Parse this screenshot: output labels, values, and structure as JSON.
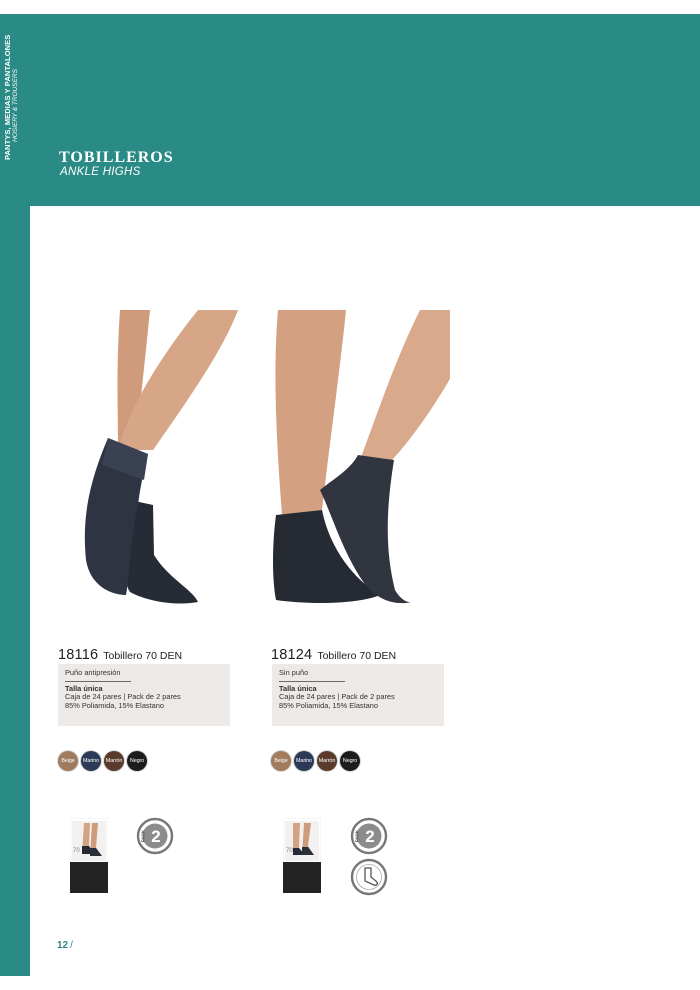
{
  "sidebar": {
    "category": "PANTYS, MEDIAS Y PANTALONES",
    "category_en": "HOSIERY & TROUSERS"
  },
  "section": {
    "title": "TOBILLEROS",
    "subtitle": "ANKLE HIGHS"
  },
  "products": [
    {
      "code": "18116",
      "name": "Tobillero 70 DEN",
      "feature": "Puño antipresión",
      "size": "Talla única",
      "packaging": "Caja de 24 pares | Pack de 2 pares",
      "composition": "85% Poliamida, 15% Elastano",
      "colors": [
        {
          "label": "Beige",
          "hex": "#a07b5e"
        },
        {
          "label": "Marino",
          "hex": "#2c3a58"
        },
        {
          "label": "Marrón",
          "hex": "#5a3a2a"
        },
        {
          "label": "Negro",
          "hex": "#1c1c1c"
        }
      ],
      "pack_badge": "2",
      "pack_badge_label": "PACK"
    },
    {
      "code": "18124",
      "name": "Tobillero 70 DEN",
      "feature": "Sin puño",
      "size": "Talla única",
      "packaging": "Caja de 24 pares | Pack de 2 pares",
      "composition": "85% Poliamida, 15% Elastano",
      "colors": [
        {
          "label": "Beige",
          "hex": "#a07b5e"
        },
        {
          "label": "Marino",
          "hex": "#2c3a58"
        },
        {
          "label": "Marrón",
          "hex": "#5a3a2a"
        },
        {
          "label": "Negro",
          "hex": "#1c1c1c"
        }
      ],
      "pack_badge": "2",
      "pack_badge_label": "PACK"
    }
  ],
  "page": {
    "number": "12",
    "separator": "/"
  },
  "colors": {
    "brand_teal": "#2a8a85"
  }
}
